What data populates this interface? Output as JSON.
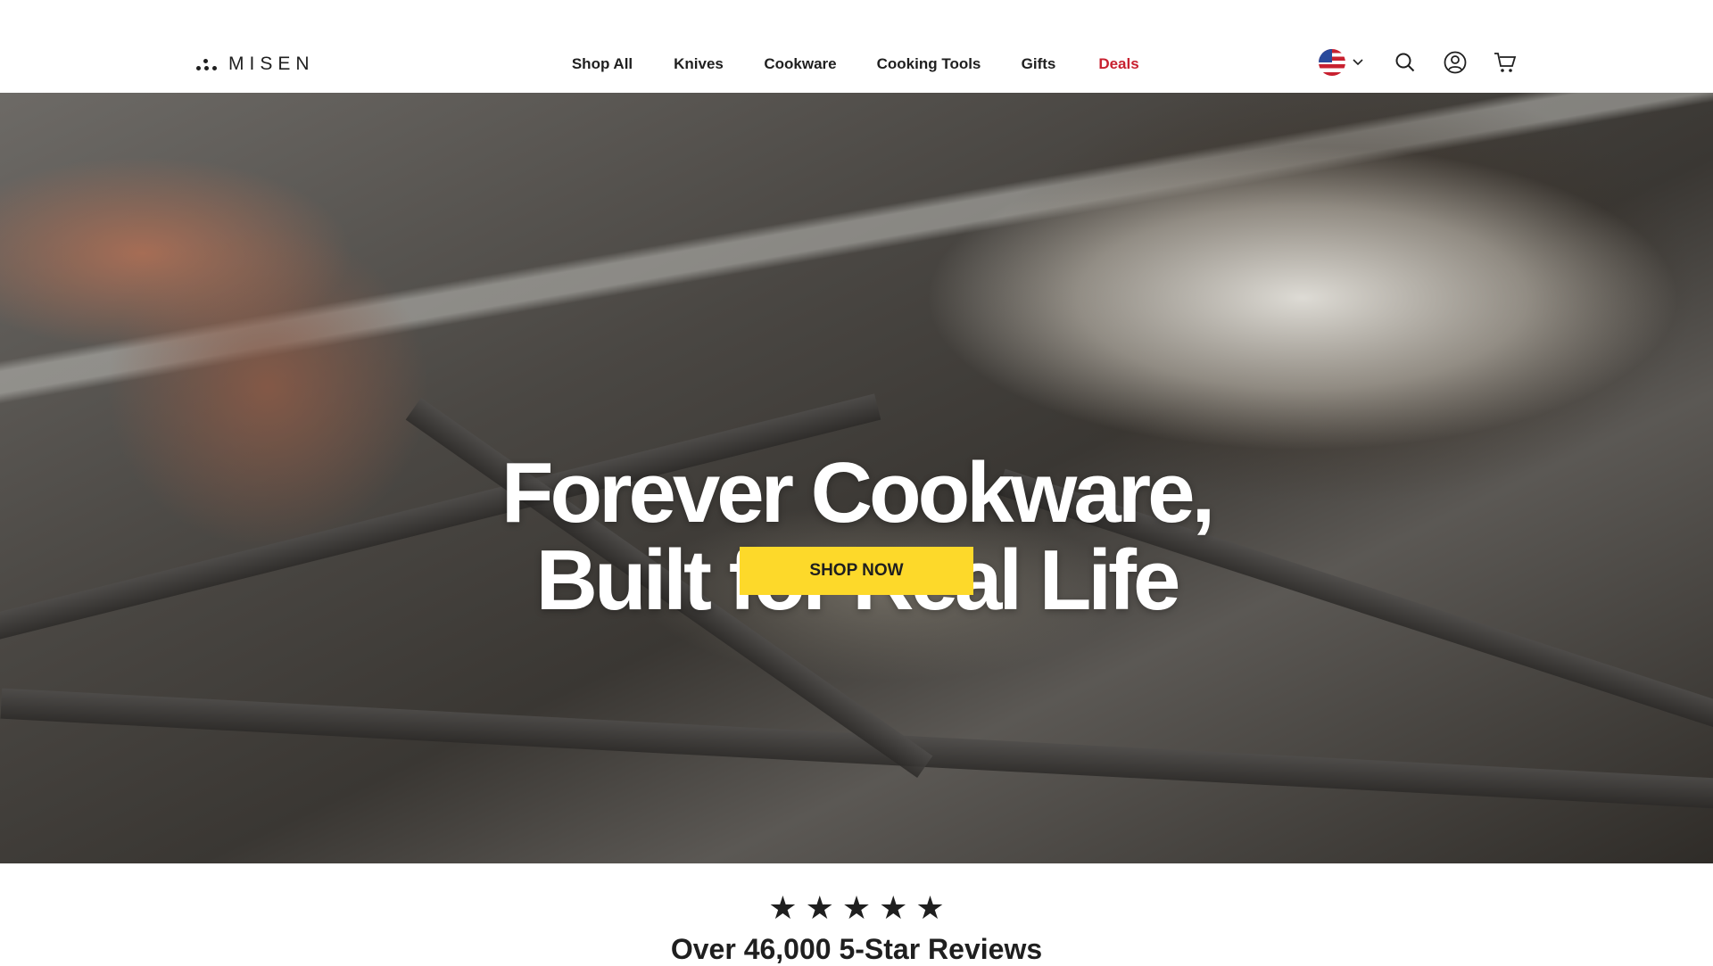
{
  "header": {
    "logo": "MISEN",
    "nav": [
      {
        "label": "Shop All"
      },
      {
        "label": "Knives"
      },
      {
        "label": "Cookware"
      },
      {
        "label": "Cooking Tools"
      },
      {
        "label": "Gifts"
      },
      {
        "label": "Deals",
        "color": "#c8202f"
      }
    ],
    "icons": [
      "us-flag-icon",
      "chevron-down-icon",
      "search-icon",
      "account-icon",
      "cart-icon"
    ]
  },
  "hero": {
    "title_line1": "Forever Cookware,",
    "title_line2": "Built for Real Life",
    "cta": "SHOP NOW",
    "cta_color": "#fdd92a"
  },
  "reviews": {
    "rating": 5,
    "max": 5,
    "text": "Over 46,000 5-Star Reviews"
  }
}
